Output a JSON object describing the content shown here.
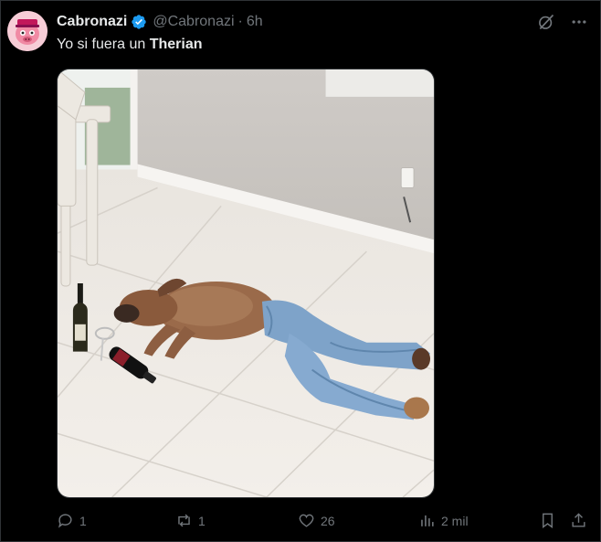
{
  "tweet": {
    "display_name": "Cabronazi",
    "handle": "@Cabronazi",
    "separator": "·",
    "time": "6h",
    "text_prefix": "Yo si fuera un ",
    "text_bold": "Therian",
    "verified": true,
    "accent_color": "#1d9bf0"
  },
  "media": {
    "alt": "Perro tirado en el suelo con pantalones vaqueros junto a botellas de vino"
  },
  "actions": {
    "replies": "1",
    "reposts": "1",
    "likes": "26",
    "views": "2 mil"
  },
  "icons": {
    "top": [
      "grok-icon",
      "more-icon"
    ],
    "actions": [
      "reply-icon",
      "repost-icon",
      "like-icon",
      "views-icon",
      "bookmark-icon",
      "share-icon"
    ]
  }
}
